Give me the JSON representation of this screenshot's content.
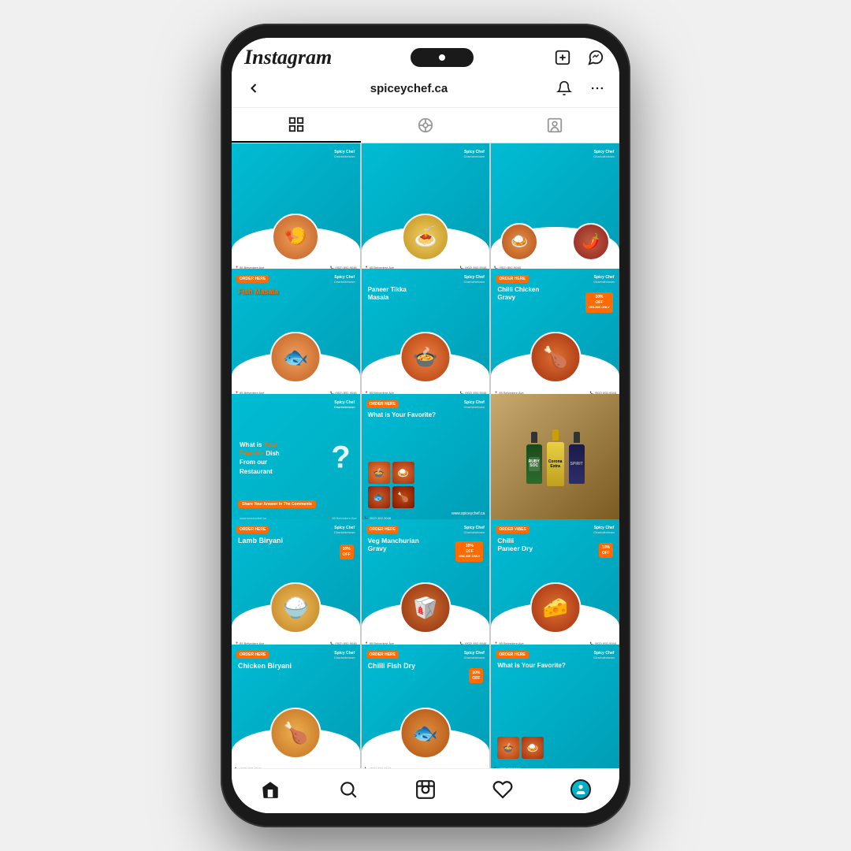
{
  "app": {
    "name": "Instagram"
  },
  "header": {
    "username": "spiceychef.ca",
    "back_label": "←",
    "notification_icon": "bell",
    "more_icon": "ellipsis"
  },
  "tabs": [
    {
      "label": "grid",
      "icon": "grid-icon",
      "active": true
    },
    {
      "label": "reels",
      "icon": "reels-icon",
      "active": false
    },
    {
      "label": "tagged",
      "icon": "person-tag-icon",
      "active": false
    }
  ],
  "posts": [
    {
      "id": 1,
      "type": "dish",
      "emoji": "🍤",
      "title": "",
      "color": "teal"
    },
    {
      "id": 2,
      "type": "dish",
      "emoji": "🍝",
      "title": "",
      "color": "teal"
    },
    {
      "id": 3,
      "type": "dish-duo",
      "emoji": "🍛",
      "title": "",
      "color": "teal"
    },
    {
      "id": 4,
      "type": "dish-named",
      "title": "Fish Masala",
      "emoji": "🐟",
      "color": "teal"
    },
    {
      "id": 5,
      "type": "dish-named",
      "title": "Paneer Tikka Masala",
      "emoji": "🍲",
      "color": "teal"
    },
    {
      "id": 6,
      "type": "dish-named",
      "title": "Chilli Chicken Gravy",
      "emoji": "🍗",
      "color": "teal"
    },
    {
      "id": 7,
      "type": "question",
      "text": "What is Your Favorite Dish From our Restaurant",
      "color": "teal"
    },
    {
      "id": 8,
      "type": "favorite-grid",
      "title": "What is Your Favorite?",
      "color": "teal"
    },
    {
      "id": 9,
      "type": "drinks",
      "color": "brown"
    },
    {
      "id": 10,
      "type": "dish-named",
      "title": "Lamb Biryani",
      "emoji": "🍚",
      "color": "teal"
    },
    {
      "id": 11,
      "type": "dish-named",
      "title": "Veg Manchurian Gravy",
      "emoji": "🥡",
      "color": "teal"
    },
    {
      "id": 12,
      "type": "dish-named",
      "title": "Chilli Paneer Dry",
      "emoji": "🧀",
      "color": "teal"
    },
    {
      "id": 13,
      "type": "dish-named",
      "title": "Chicken Biryani",
      "emoji": "🍗",
      "color": "teal"
    },
    {
      "id": 14,
      "type": "dish-named",
      "title": "Chilli Fish Dry",
      "emoji": "🐟",
      "color": "teal"
    },
    {
      "id": 15,
      "type": "favorite-grid2",
      "title": "What is Your Favorite?",
      "color": "teal"
    }
  ],
  "nav": {
    "items": [
      {
        "name": "home",
        "icon": "home-icon"
      },
      {
        "name": "search",
        "icon": "search-icon"
      },
      {
        "name": "reels",
        "icon": "reels-nav-icon"
      },
      {
        "name": "heart",
        "icon": "heart-icon"
      },
      {
        "name": "profile",
        "icon": "profile-icon"
      }
    ]
  },
  "phone": {
    "number": "(902) 892-9048",
    "address": "85 Belvedere Ave, Charlottetown, PE C1A 6B2",
    "website": "www.spiceychef.ca"
  },
  "colors": {
    "teal": "#00bcd4",
    "orange": "#FF6B00",
    "dark": "#1a1a1a"
  }
}
